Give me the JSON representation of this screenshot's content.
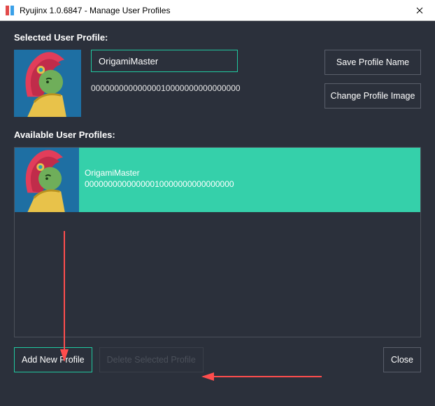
{
  "window": {
    "title": "Ryujinx 1.0.6847 - Manage User Profiles"
  },
  "labels": {
    "selected": "Selected User Profile:",
    "available": "Available User Profiles:"
  },
  "selected": {
    "name_value": "OrigamiMaster",
    "uid": "00000000000000010000000000000000"
  },
  "buttons": {
    "save_name": "Save Profile Name",
    "change_image": "Change Profile Image",
    "add_new": "Add New Profile",
    "delete_selected": "Delete Selected Profile",
    "close": "Close"
  },
  "profiles": [
    {
      "name": "OrigamiMaster",
      "uid": "00000000000000010000000000000000"
    }
  ]
}
